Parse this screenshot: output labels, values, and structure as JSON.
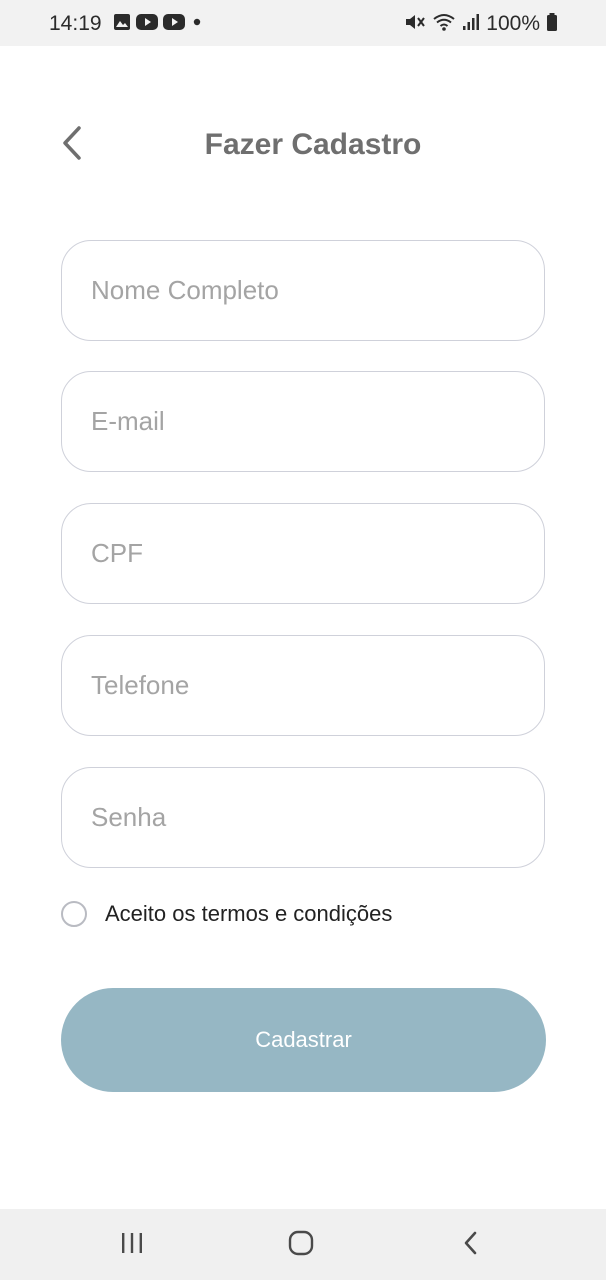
{
  "status_bar": {
    "time": "14:19",
    "battery": "100%",
    "left_icons": [
      "image-icon",
      "youtube-icon",
      "youtube-icon",
      "dot-icon"
    ],
    "right_icons": [
      "mute-icon",
      "wifi-icon",
      "signal-icon",
      "battery-icon"
    ]
  },
  "header": {
    "title": "Fazer Cadastro",
    "back_icon": "chevron-left-icon"
  },
  "form": {
    "name": {
      "placeholder": "Nome Completo",
      "value": ""
    },
    "email": {
      "placeholder": "E-mail",
      "value": ""
    },
    "cpf": {
      "placeholder": "CPF",
      "value": ""
    },
    "phone": {
      "placeholder": "Telefone",
      "value": ""
    },
    "password": {
      "placeholder": "Senha",
      "value": ""
    },
    "terms_label": "Aceito os termos e condições",
    "terms_checked": false,
    "submit_label": "Cadastrar"
  },
  "colors": {
    "button": "#96b7c4",
    "title": "#6f6f6f",
    "field_border": "#cfd1da",
    "placeholder": "#a4a4a4"
  },
  "nav_bar": {
    "icons": [
      "recent-apps-icon",
      "home-icon",
      "back-icon"
    ]
  }
}
